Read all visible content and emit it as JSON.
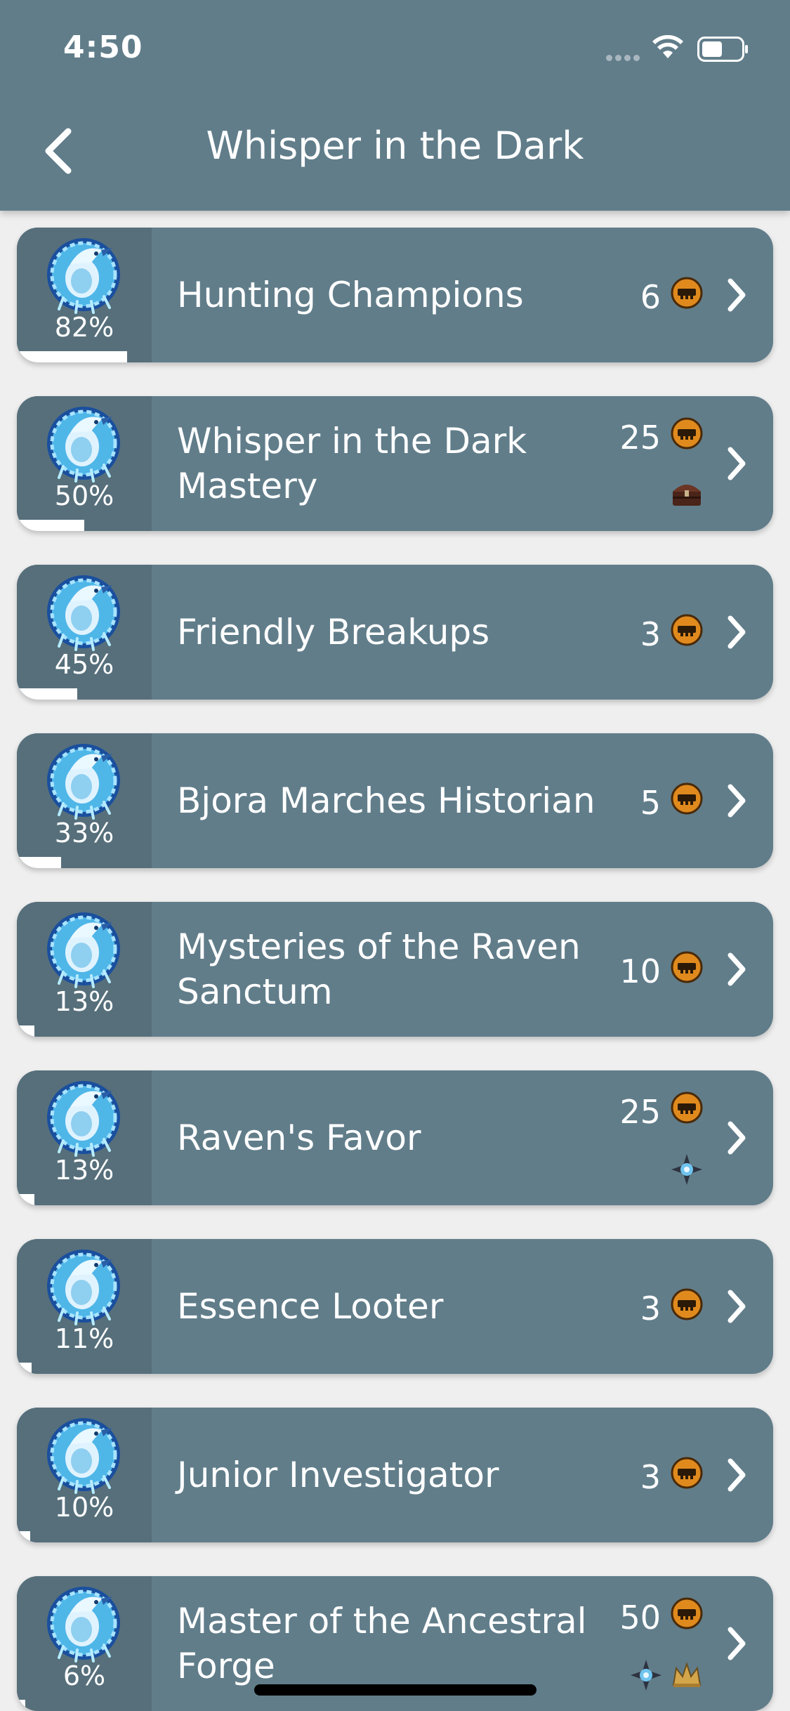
{
  "status_bar": {
    "time": "4:50"
  },
  "nav": {
    "title": "Whisper in the Dark"
  },
  "achievements": [
    {
      "title": "Hunting Champions",
      "percent": "82%",
      "progress": 0.82,
      "points": "6",
      "rewards": []
    },
    {
      "title": "Whisper in the Dark Mastery",
      "percent": "50%",
      "progress": 0.5,
      "points": "25",
      "rewards": [
        "treasure-chest-icon"
      ]
    },
    {
      "title": "Friendly Breakups",
      "percent": "45%",
      "progress": 0.45,
      "points": "3",
      "rewards": []
    },
    {
      "title": "Bjora Marches Historian",
      "percent": "33%",
      "progress": 0.33,
      "points": "5",
      "rewards": []
    },
    {
      "title": "Mysteries of the Raven Sanctum",
      "percent": "13%",
      "progress": 0.13,
      "points": "10",
      "rewards": []
    },
    {
      "title": "Raven's Favor",
      "percent": "13%",
      "progress": 0.13,
      "points": "25",
      "rewards": [
        "mastery-star-icon"
      ]
    },
    {
      "title": "Essence Looter",
      "percent": "11%",
      "progress": 0.11,
      "points": "3",
      "rewards": []
    },
    {
      "title": "Junior Investigator",
      "percent": "10%",
      "progress": 0.1,
      "points": "3",
      "rewards": []
    },
    {
      "title": "Master of the Ancestral Forge",
      "percent": "6%",
      "progress": 0.06,
      "points": "50",
      "rewards": [
        "mastery-star-icon",
        "crown-title-icon"
      ]
    }
  ],
  "colors": {
    "header_bg": "#617d8a",
    "card_bg": "#617d8a",
    "card_icon_panel": "#566f7b",
    "page_bg": "#efefef",
    "text": "#ffffff",
    "coin": "#e08a1e"
  }
}
